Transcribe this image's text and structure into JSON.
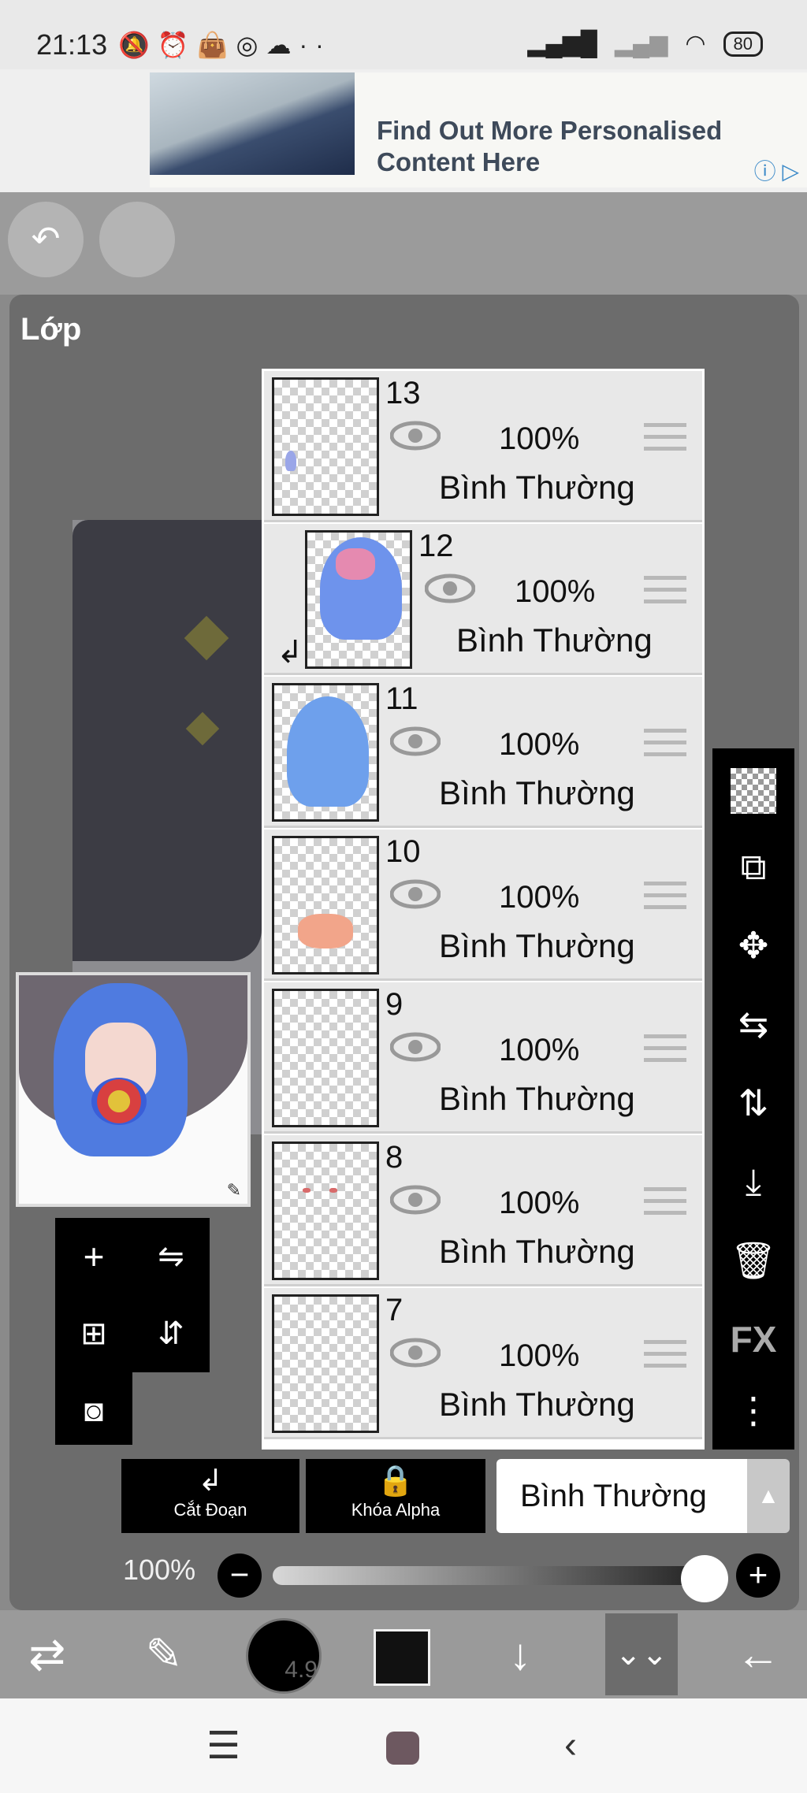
{
  "status_bar": {
    "time": "21:13",
    "notification_icons": [
      "muted-bell-icon",
      "alarm-icon",
      "bag-icon",
      "instagram-icon",
      "cloud-icon",
      "more-dots-icon"
    ],
    "battery": "80"
  },
  "ad": {
    "headline": "Find Out More Personalised",
    "headline_line2": "Content Here"
  },
  "panel": {
    "title": "Lớp"
  },
  "layers": [
    {
      "number": "13",
      "opacity": "100%",
      "blend": "Bình Thường"
    },
    {
      "number": "12",
      "opacity": "100%",
      "blend": "Bình Thường",
      "clipped": true
    },
    {
      "number": "11",
      "opacity": "100%",
      "blend": "Bình Thường"
    },
    {
      "number": "10",
      "opacity": "100%",
      "blend": "Bình Thường"
    },
    {
      "number": "9",
      "opacity": "100%",
      "blend": "Bình Thường"
    },
    {
      "number": "8",
      "opacity": "100%",
      "blend": "Bình Thường"
    },
    {
      "number": "7",
      "opacity": "100%",
      "blend": "Bình Thường"
    }
  ],
  "right_toolbar": {
    "fx_label": "FX"
  },
  "buttons": {
    "clipping_label": "Cắt Đoạn",
    "alpha_lock_label": "Khóa Alpha",
    "blend_mode": "Bình Thường"
  },
  "opacity": {
    "label": "100%",
    "value": 1.0
  },
  "brush": {
    "size": "4.9",
    "color": "#111111"
  }
}
